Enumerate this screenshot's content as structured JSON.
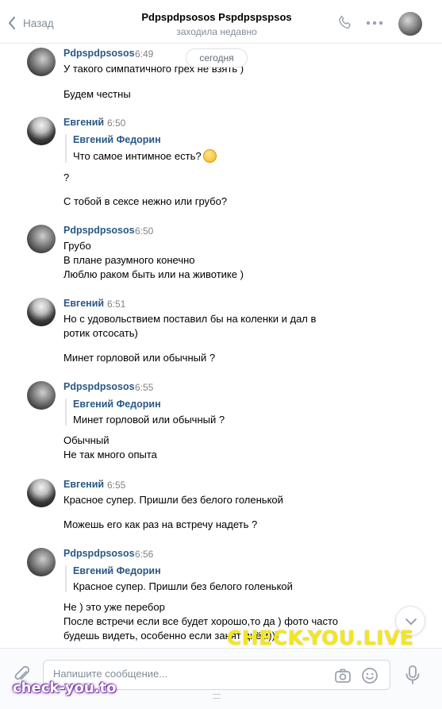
{
  "header": {
    "back_label": "Назад",
    "title": "Pdpspdpsosos Pspdpspspsos",
    "status": "заходила недавно"
  },
  "date_pill": "сегодня",
  "messages": [
    {
      "author": "Pdpspdpsosos",
      "time": "6:49",
      "avatar": "pdpspdpsosos",
      "lines": [
        "У такого симпатичного грех не взять )",
        "Будем честны"
      ]
    },
    {
      "author": "Евгений",
      "time": "6:50",
      "avatar": "evgeny",
      "quote": {
        "author": "Евгений Федорин",
        "text": "Что самое интимное есть?",
        "emoji": "thinking-face-emoji"
      },
      "lines": [
        "?",
        "С тобой в сексе нежно или грубо?"
      ]
    },
    {
      "author": "Pdpspdpsosos",
      "time": "6:50",
      "avatar": "pdpspdpsosos",
      "lines": [
        "Грубо",
        "В плане разумного конечно",
        "Люблю раком быть или на животике )"
      ]
    },
    {
      "author": "Евгений",
      "time": "6:51",
      "avatar": "evgeny",
      "lines": [
        "Но с удовольствием поставил бы на коленки и дал в",
        "ротик отсосать)",
        "Минет горловой или обычный ?"
      ]
    },
    {
      "author": "Pdpspdpsosos",
      "time": "6:55",
      "avatar": "pdpspdpsosos",
      "quote": {
        "author": "Евгений Федорин",
        "text": "Минет горловой или обычный ?"
      },
      "lines": [
        "Обычный",
        "Не так много опыта"
      ]
    },
    {
      "author": "Евгений",
      "time": "6:55",
      "avatar": "evgeny",
      "lines": [
        "Красное супер. Пришли без белого голенькой",
        "Можешь его как раз на встречу надеть ?"
      ]
    },
    {
      "author": "Pdpspdpsosos",
      "time": "6:56",
      "avatar": "pdpspdpsosos",
      "quote": {
        "author": "Евгений Федорин",
        "text": "Красное супер. Пришли без белого голенькой"
      },
      "lines": [
        "Не ) это уже перебор",
        "После встречи если все будет хорошо,то да ) фото часто",
        "будешь видеть, особенно если занят днём)))"
      ]
    }
  ],
  "composer": {
    "placeholder": "Напишите сообщение..."
  },
  "watermarks": {
    "main": "CHECK-YOU.LIVE",
    "corner": "check-you.to"
  },
  "colors": {
    "link": "#2a5885",
    "muted": "#818c99",
    "watermark_yellow": "#f3e61c",
    "watermark_purple": "#7a39a8"
  }
}
